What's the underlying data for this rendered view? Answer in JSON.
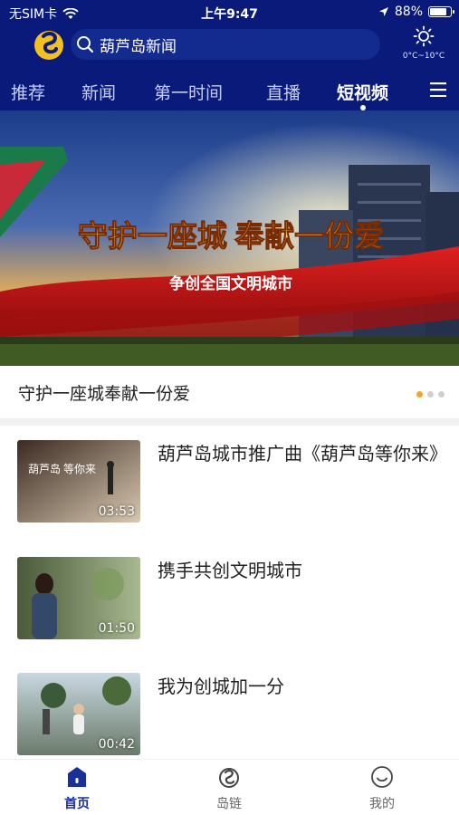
{
  "status_bar": {
    "carrier": "无SIM卡",
    "time": "上午9:47",
    "battery": "88%",
    "battery_level": 0.88
  },
  "header": {
    "search_placeholder": "葫芦岛新闻",
    "weather_temp": "0°C~10°C"
  },
  "tabs": [
    {
      "label": "推荐",
      "active": false
    },
    {
      "label": "新闻",
      "active": false
    },
    {
      "label": "第一时间",
      "active": false
    },
    {
      "label": "直播",
      "active": false
    },
    {
      "label": "短视频",
      "active": true
    }
  ],
  "banner": {
    "headline": "守护一座城  奉献一份爱",
    "subheadline": "争创全国文明城市",
    "caption": "守护一座城奉献一份爱",
    "slide_count": 3,
    "active_slide": 1
  },
  "videos": [
    {
      "title": "葫芦岛城市推广曲《葫芦岛等你来》",
      "duration": "03:53",
      "thumb_text": "葫芦岛 等你来"
    },
    {
      "title": "携手共创文明城市",
      "duration": "01:50"
    },
    {
      "title": "我为创城加一分",
      "duration": "00:42"
    }
  ],
  "bottom_nav": [
    {
      "label": "首页",
      "active": true,
      "icon": "home-icon"
    },
    {
      "label": "岛链",
      "active": false,
      "icon": "daolian-logo-icon"
    },
    {
      "label": "我的",
      "active": false,
      "icon": "smile-face-icon"
    }
  ],
  "colors": {
    "header_bg": "#0a1a7a",
    "accent": "#1a2f9a",
    "dot_active": "#f0a530"
  }
}
